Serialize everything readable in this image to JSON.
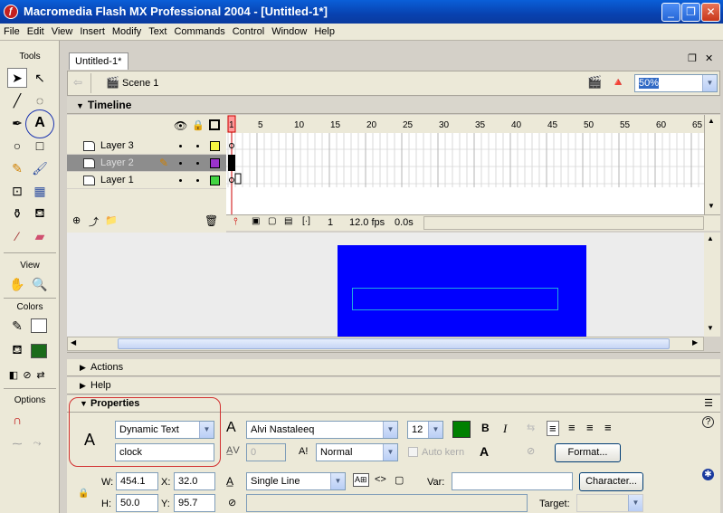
{
  "window": {
    "title": "Macromedia Flash MX Professional 2004 - [Untitled-1*]",
    "buttons": [
      "_",
      "❐",
      "✕"
    ]
  },
  "menu": [
    "File",
    "Edit",
    "View",
    "Insert",
    "Modify",
    "Text",
    "Commands",
    "Control",
    "Window",
    "Help"
  ],
  "tools": {
    "title": "Tools",
    "view_label": "View",
    "colors_label": "Colors",
    "options_label": "Options"
  },
  "document": {
    "tab": "Untitled-1*",
    "scene": "Scene 1",
    "zoom": "50%",
    "restore_btn": "❐",
    "close_btn": "✕"
  },
  "timeline": {
    "title": "Timeline",
    "frame_numbers": [
      "1",
      "5",
      "10",
      "15",
      "20",
      "25",
      "30",
      "35",
      "40",
      "45",
      "50",
      "55",
      "60",
      "65"
    ],
    "layers": [
      {
        "name": "Layer 3",
        "color": "#f5f542",
        "selected": false
      },
      {
        "name": "Layer 2",
        "color": "#9b33cc",
        "selected": true
      },
      {
        "name": "Layer 1",
        "color": "#42d442",
        "selected": false
      }
    ],
    "current_frame": "1",
    "fps": "12.0 fps",
    "time": "0.0s"
  },
  "panels": {
    "actions": "Actions",
    "help": "Help",
    "properties": "Properties"
  },
  "properties": {
    "text_type": "Dynamic Text",
    "instance_name": "clock",
    "font": "Alvi Nastaleeq",
    "font_size": "12",
    "letter_spacing": "0",
    "baseline": "Normal",
    "auto_kern": "Auto kern",
    "format_btn": "Format...",
    "w_label": "W:",
    "w": "454.1",
    "x_label": "X:",
    "x": "32.0",
    "h_label": "H:",
    "h": "50.0",
    "y_label": "Y:",
    "y": "95.7",
    "line_type": "Single Line",
    "var_label": "Var:",
    "character_btn": "Character...",
    "target_label": "Target:",
    "bold": "B",
    "italic": "I"
  },
  "colors": {
    "stage": "#0000ff",
    "text_color": "#008000",
    "annotation_red": "#d23030",
    "annotation_blue": "#1a33b0"
  }
}
